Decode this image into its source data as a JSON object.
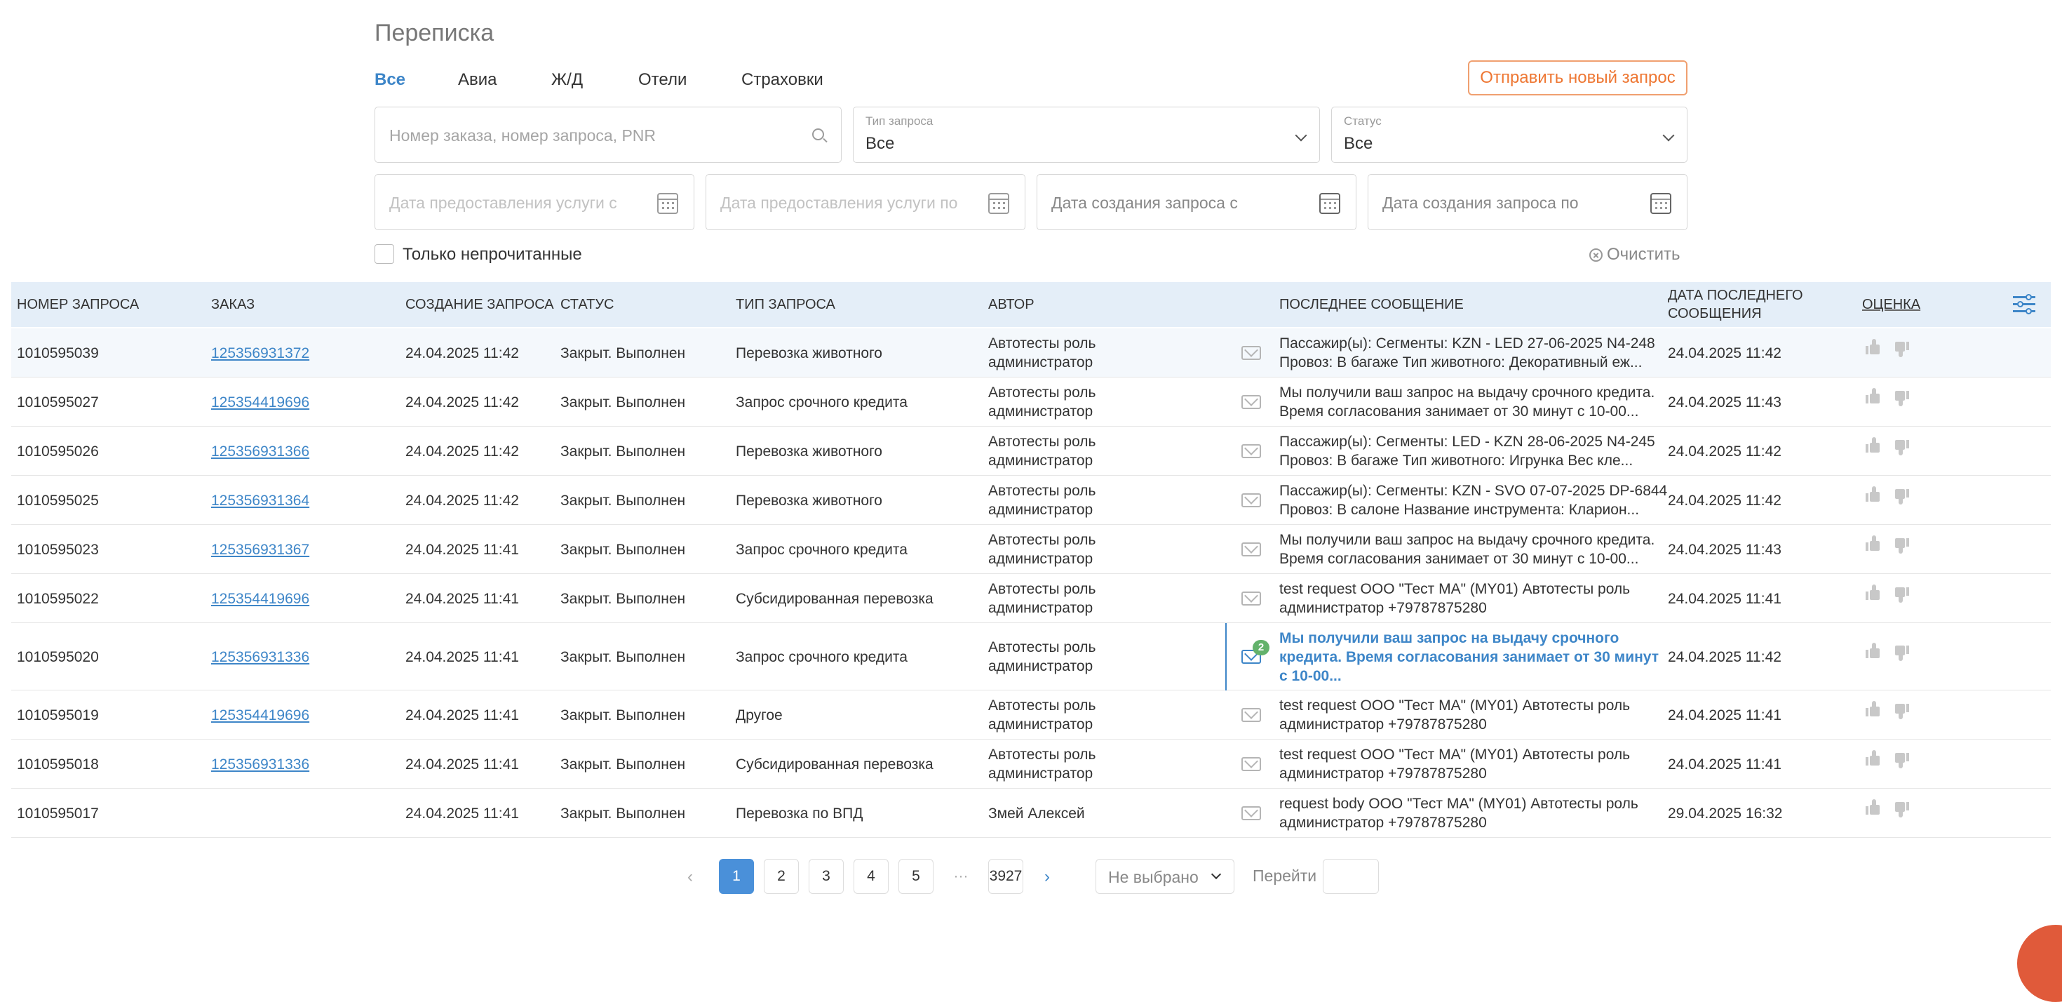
{
  "page": {
    "title": "Переписка"
  },
  "tabs": [
    "Все",
    "Авиа",
    "Ж/Д",
    "Отели",
    "Страховки"
  ],
  "actions": {
    "new_request": "Отправить новый запрос",
    "clear": "Очистить"
  },
  "filters": {
    "search_placeholder": "Номер заказа, номер запроса, PNR",
    "request_type": {
      "label": "Тип запроса",
      "value": "Все"
    },
    "status": {
      "label": "Статус",
      "value": "Все"
    },
    "date_service_from": "Дата предоставления услуги с",
    "date_service_to": "Дата предоставления услуги по",
    "date_created_from": "Дата создания запроса с",
    "date_created_to": "Дата создания запроса по",
    "unread_only": "Только непрочитанные"
  },
  "table": {
    "headers": {
      "number": "НОМЕР ЗАПРОСА",
      "order": "ЗАКАЗ",
      "created": "СОЗДАНИЕ ЗАПРОСА",
      "status": "СТАТУС",
      "type": "ТИП ЗАПРОСА",
      "author": "АВТОР",
      "last_message": "ПОСЛЕДНЕЕ СООБЩЕНИЕ",
      "last_date_1": "ДАТА ПОСЛЕДНЕГО",
      "last_date_2": "СООБЩЕНИЯ",
      "rating": "ОЦЕНКА"
    },
    "rows": [
      {
        "number": "1010595039",
        "order": "125356931372",
        "created": "24.04.2025 11:42",
        "status": "Закрыт. Выполнен",
        "type": "Перевозка животного",
        "author1": "Автотесты роль",
        "author2": "администратор",
        "msg1": "Пассажир(ы): Сегменты: KZN - LED 27-06-2025 N4-248",
        "msg2": "Провоз: В багаже Тип животного: Декоративный еж...",
        "msg3": "",
        "last": "24.04.2025 11:42",
        "badge": ""
      },
      {
        "number": "1010595027",
        "order": "125354419696",
        "created": "24.04.2025 11:42",
        "status": "Закрыт. Выполнен",
        "type": "Запрос срочного кредита",
        "author1": "Автотесты роль",
        "author2": "администратор",
        "msg1": "Мы получили ваш запрос на выдачу срочного кредита.",
        "msg2": "Время согласования занимает от 30 минут с 10-00...",
        "msg3": "",
        "last": "24.04.2025 11:43",
        "badge": ""
      },
      {
        "number": "1010595026",
        "order": "125356931366",
        "created": "24.04.2025 11:42",
        "status": "Закрыт. Выполнен",
        "type": "Перевозка животного",
        "author1": "Автотесты роль",
        "author2": "администратор",
        "msg1": "Пассажир(ы): Сегменты: LED - KZN 28-06-2025 N4-245",
        "msg2": "Провоз: В багаже Тип животного: Игрунка Вес кле...",
        "msg3": "",
        "last": "24.04.2025 11:42",
        "badge": ""
      },
      {
        "number": "1010595025",
        "order": "125356931364",
        "created": "24.04.2025 11:42",
        "status": "Закрыт. Выполнен",
        "type": "Перевозка животного",
        "author1": "Автотесты роль",
        "author2": "администратор",
        "msg1": "Пассажир(ы): Сегменты: KZN - SVO 07-07-2025 DP-6844",
        "msg2": "Провоз: В салоне Название инструмента: Кларион...",
        "msg3": "",
        "last": "24.04.2025 11:42",
        "badge": ""
      },
      {
        "number": "1010595023",
        "order": "125356931367",
        "created": "24.04.2025 11:41",
        "status": "Закрыт. Выполнен",
        "type": "Запрос срочного кредита",
        "author1": "Автотесты роль",
        "author2": "администратор",
        "msg1": "Мы получили ваш запрос на выдачу срочного кредита.",
        "msg2": "Время согласования занимает от 30 минут с 10-00...",
        "msg3": "",
        "last": "24.04.2025 11:43",
        "badge": ""
      },
      {
        "number": "1010595022",
        "order": "125354419696",
        "created": "24.04.2025 11:41",
        "status": "Закрыт. Выполнен",
        "type": "Субсидированная перевозка",
        "author1": "Автотесты роль",
        "author2": "администратор",
        "msg1": "test request ООО \"Тест МА\" (MY01) Автотесты роль",
        "msg2": "администратор +79787875280",
        "msg3": "",
        "last": "24.04.2025 11:41",
        "badge": ""
      },
      {
        "number": "1010595020",
        "order": "125356931336",
        "created": "24.04.2025 11:41",
        "status": "Закрыт. Выполнен",
        "type": "Запрос срочного кредита",
        "author1": "Автотесты роль",
        "author2": "администратор",
        "msg1": "Мы получили ваш запрос на выдачу срочного",
        "msg2": "кредита. Время согласования занимает от 30 минут",
        "msg3": "с 10-00...",
        "last": "24.04.2025 11:42",
        "badge": "2"
      },
      {
        "number": "1010595019",
        "order": "125354419696",
        "created": "24.04.2025 11:41",
        "status": "Закрыт. Выполнен",
        "type": "Другое",
        "author1": "Автотесты роль",
        "author2": "администратор",
        "msg1": "test request ООО \"Тест МА\" (MY01) Автотесты роль",
        "msg2": "администратор +79787875280",
        "msg3": "",
        "last": "24.04.2025 11:41",
        "badge": ""
      },
      {
        "number": "1010595018",
        "order": "125356931336",
        "created": "24.04.2025 11:41",
        "status": "Закрыт. Выполнен",
        "type": "Субсидированная перевозка",
        "author1": "Автотесты роль",
        "author2": "администратор",
        "msg1": "test request ООО \"Тест МА\" (MY01) Автотесты роль",
        "msg2": "администратор +79787875280",
        "msg3": "",
        "last": "24.04.2025 11:41",
        "badge": ""
      },
      {
        "number": "1010595017",
        "order": "",
        "created": "24.04.2025 11:41",
        "status": "Закрыт. Выполнен",
        "type": "Перевозка по ВПД",
        "author1": "Змей Алексей",
        "author2": "",
        "msg1": "request body ООО \"Тест МА\" (MY01) Автотесты роль",
        "msg2": "администратор +79787875280",
        "msg3": "",
        "last": "29.04.2025 16:32",
        "badge": ""
      }
    ]
  },
  "pagination": {
    "prev": "‹",
    "next": "›",
    "pages": [
      "1",
      "2",
      "3",
      "4",
      "5"
    ],
    "ellipsis": "···",
    "last_page": "3927",
    "page_size": "Не выбрано",
    "goto": "Перейти"
  },
  "colors": {
    "accent": "#3e86c8",
    "orange": "#ee7733",
    "header_bg": "#e4eef8",
    "badge": "#63b26b"
  }
}
